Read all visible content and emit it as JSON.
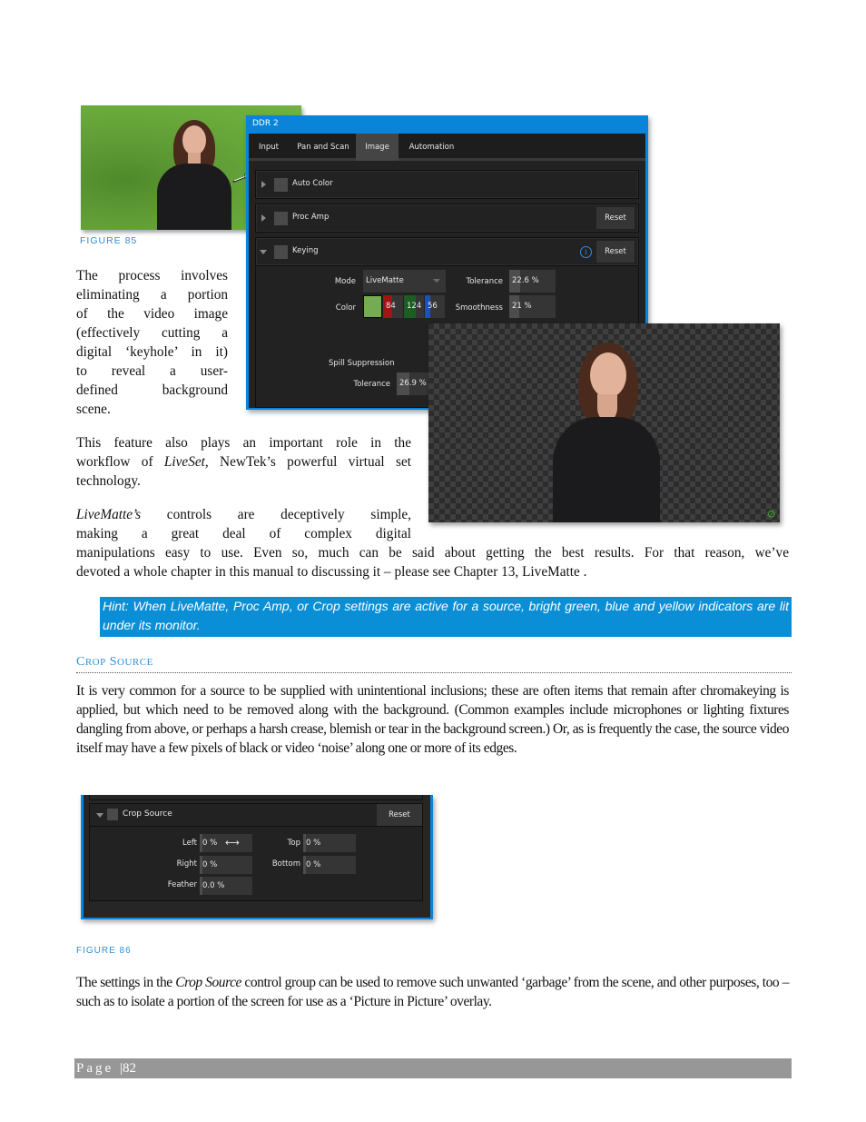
{
  "figure85": {
    "caption": "FIGURE 85",
    "ddr_panel": {
      "title": "DDR 2",
      "tabs": [
        {
          "label": "Input",
          "active": false
        },
        {
          "label": "Pan and Scan",
          "active": false
        },
        {
          "label": "Image",
          "active": true
        },
        {
          "label": "Automation",
          "active": false
        }
      ],
      "groups": [
        {
          "label": "Auto Color",
          "expanded": false,
          "has_reset": false
        },
        {
          "label": "Proc Amp",
          "expanded": false,
          "has_reset": true
        },
        {
          "label": "Keying",
          "expanded": true,
          "has_reset": true,
          "has_info": true
        }
      ],
      "reset_label": "Reset",
      "info_glyph": "i",
      "keying": {
        "mode_label": "Mode",
        "mode_value": "LiveMatte",
        "color_label": "Color",
        "swatch_color": "#75ab52",
        "color_r": "84",
        "color_g": "124",
        "color_b": "56",
        "tolerance_label": "Tolerance",
        "tolerance_value": "22.6 %",
        "smoothness_label": "Smoothness",
        "smoothness_value": "21 %",
        "spill_label": "Spill Suppression",
        "spill_tolerance_label": "Tolerance",
        "spill_tolerance_value": "26.9 %"
      }
    }
  },
  "paragraphs": {
    "process_lines": [
      "The process involves",
      "eliminating a portion",
      "of the video image",
      "(effectively cutting a",
      "digital ‘keyhole’ in it)",
      "to reveal a user-",
      "defined background",
      "scene."
    ],
    "feature_lines": [
      "This feature also plays an important role in the",
      "workflow of ",
      "LiveSet",
      ", NewTek’s powerful virtual set",
      "technology."
    ],
    "controls": {
      "line1_italic": "LiveMatte’s",
      "line1_rest": " controls are deceptively simple,",
      "line2": "making a great deal of complex digital",
      "line3": "manipulations easy to use.  Even so, much can be said about getting the best results.  For that reason, we’ve",
      "line4": "devoted a whole chapter in this manual to discussing it – please see Chapter 13, LiveMatte ."
    }
  },
  "hint": "Hint: When LiveMatte, Proc Amp, or Crop settings are active for a source, bright green, blue and yellow indicators are lit under its monitor.",
  "crop_section": {
    "title_first_cap": "C",
    "title_first_rest": "ROP",
    "title_second_cap": "S",
    "title_second_rest": "OURCE",
    "body": "It is very common for a source to be supplied with unintentional inclusions; these are often items that remain after chromakeying is applied, but which need to be removed along with the background. (Common examples include microphones or lighting fixtures dangling from above, or perhaps a harsh crease, blemish or tear in the background screen.)  Or, as is frequently the case, the source video itself may have a few pixels of black or video ‘noise’ along one or more of its edges."
  },
  "figure86": {
    "caption": "FIGURE 86",
    "panel": {
      "group_label": "Crop Source",
      "reset_label": "Reset",
      "fields": {
        "left_label": "Left",
        "left_value": "0 %",
        "top_label": "Top",
        "top_value": "0 %",
        "right_label": "Right",
        "right_value": "0 %",
        "bottom_label": "Bottom",
        "bottom_value": "0 %",
        "feather_label": "Feather",
        "feather_value": "0.0 %"
      },
      "cursor_glyph": "⟷"
    }
  },
  "closing": {
    "before": "The settings in the ",
    "italic": "Crop Source",
    "after": " control group can be used to remove such unwanted ‘garbage’ from the scene, and other purposes, too – such as to isolate a portion of the screen for use as a ‘Picture in Picture’ overlay."
  },
  "footer": {
    "page_label": "Page",
    "separator": "|",
    "page_number": "82"
  }
}
